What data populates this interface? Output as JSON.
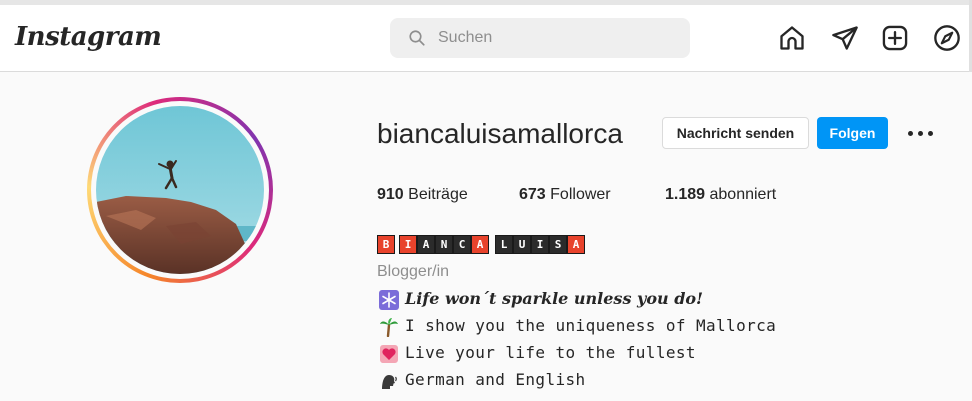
{
  "header": {
    "logo": "Instagram",
    "search_placeholder": "Suchen",
    "nav_icons": [
      "home-icon",
      "direct-message-icon",
      "new-post-icon",
      "explore-icon"
    ]
  },
  "profile": {
    "username": "biancaluisamallorca",
    "message_button": "Nachricht senden",
    "follow_button": "Folgen",
    "stats": {
      "posts_count": "910",
      "posts_label": "Beiträge",
      "followers_count": "673",
      "followers_label": "Follower",
      "following_count": "1.189",
      "following_label": "abonniert"
    },
    "name_letters": [
      "B",
      "I",
      "A",
      "N",
      "C",
      "A",
      "L",
      "U",
      "I",
      "S",
      "A"
    ],
    "category": "Blogger/in",
    "bio": [
      {
        "icon": "snowflake-icon",
        "text": "Life won´t sparkle unless you do!"
      },
      {
        "icon": "palm-tree-icon",
        "text": "I show you the uniqueness of Mallorca"
      },
      {
        "icon": "heart-icon",
        "text": "Live your life to the fullest"
      },
      {
        "icon": "speaking-head-icon",
        "text": "German and English"
      }
    ]
  },
  "colors": {
    "accent_blue": "#0095f6",
    "name_red": "#e8432c",
    "name_dark": "#2b2b2b"
  }
}
